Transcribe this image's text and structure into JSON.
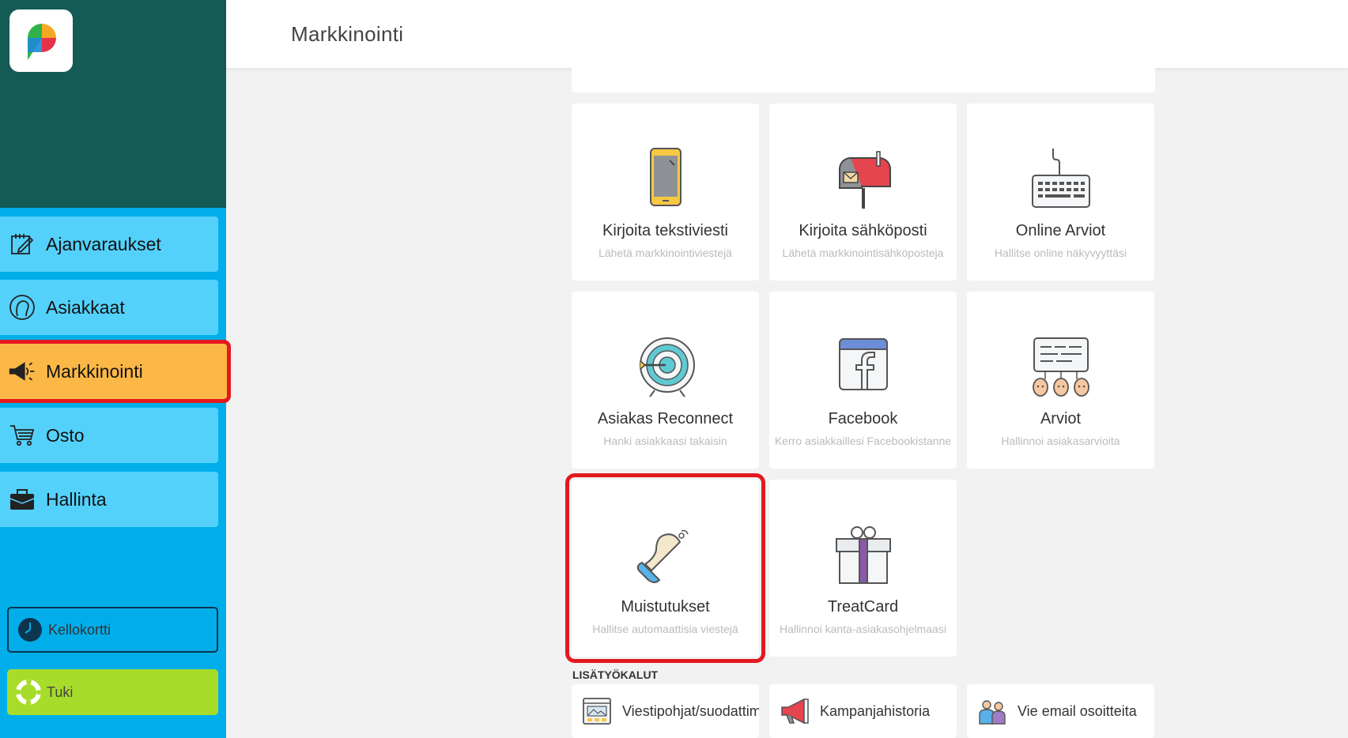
{
  "header": {
    "title": "Markkinointi"
  },
  "sidebar": {
    "items": [
      {
        "label": "Ajanvaraukset",
        "icon": "calendar-edit-icon"
      },
      {
        "label": "Asiakkaat",
        "icon": "customer-head-icon"
      },
      {
        "label": "Markkinointi",
        "icon": "megaphone-icon",
        "active": true
      },
      {
        "label": "Osto",
        "icon": "cart-icon"
      },
      {
        "label": "Hallinta",
        "icon": "briefcase-icon"
      }
    ],
    "kellokortti": "Kellokortti",
    "tuki": "Tuki"
  },
  "cards": [
    {
      "title": "Kirjoita tekstiviesti",
      "subtitle": "Lähetä markkinointiviestejä",
      "icon": "phone-icon"
    },
    {
      "title": "Kirjoita sähköposti",
      "subtitle": "Lähetä markkinointisähköposteja",
      "icon": "mailbox-icon"
    },
    {
      "title": "Online Arviot",
      "subtitle": "Hallitse online näkyvyyttäsi",
      "icon": "keyboard-icon"
    },
    {
      "title": "Asiakas Reconnect",
      "subtitle": "Hanki asiakkaasi takaisin",
      "icon": "target-icon"
    },
    {
      "title": "Facebook",
      "subtitle": "Kerro asiakkaillesi Facebookistanne",
      "icon": "facebook-icon"
    },
    {
      "title": "Arviot",
      "subtitle": "Hallinnoi asiakasarvioita",
      "icon": "reviews-icon"
    },
    {
      "title": "Muistutukset",
      "subtitle": "Hallitse automaattisia viestejä",
      "icon": "bell-icon"
    },
    {
      "title": "TreatCard",
      "subtitle": "Hallinnoi kanta-asiakasohjelmaasi",
      "icon": "gift-icon"
    }
  ],
  "tools": {
    "heading": "LISÄTYÖKALUT",
    "items": [
      {
        "label": "Viestipohjat/suodattimet",
        "icon": "template-icon"
      },
      {
        "label": "Kampanjahistoria",
        "icon": "megaphone-icon"
      },
      {
        "label": "Vie email osoitteita",
        "icon": "people-icon"
      }
    ]
  },
  "colors": {
    "sidebar_top": "#145a55",
    "sidebar": "#02aeea",
    "nav_item": "#54d1fb",
    "active": "#fcb846",
    "highlight": "#e3191f",
    "tuki": "#a8dc2a"
  }
}
